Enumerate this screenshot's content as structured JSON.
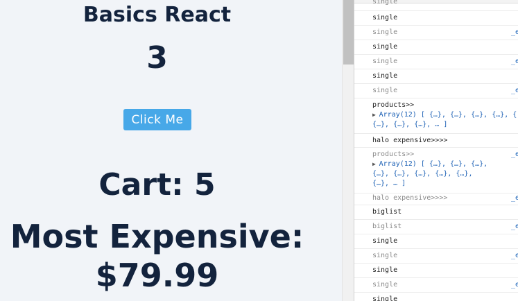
{
  "app": {
    "title": "Basics React",
    "counter": "3",
    "button_label": "Click Me",
    "cart_text": "Cart: 5",
    "expensive_line1": "Most Expensive:",
    "expensive_line2": "$79.99"
  },
  "console": {
    "rows": [
      {
        "text": "single",
        "dim": true,
        "source": ""
      },
      {
        "text": "single",
        "dim": false,
        "source": ""
      },
      {
        "text": "single",
        "dim": true,
        "source": "_e"
      },
      {
        "text": "single",
        "dim": false,
        "source": ""
      },
      {
        "text": "single",
        "dim": true,
        "source": "_e"
      },
      {
        "text": "single",
        "dim": false,
        "source": ""
      },
      {
        "text": "single",
        "dim": true,
        "source": "_e"
      },
      {
        "text": "products>>",
        "dim": false,
        "source": ""
      },
      {
        "text": "halo expensive>>>>",
        "dim": false,
        "source": ""
      },
      {
        "text": "products>>",
        "dim": true,
        "source": "_e"
      },
      {
        "text": "halo expensive>>>>",
        "dim": true,
        "source": "_e"
      },
      {
        "text": "biglist",
        "dim": false,
        "source": ""
      },
      {
        "text": "biglist",
        "dim": true,
        "source": "_e"
      },
      {
        "text": "single",
        "dim": false,
        "source": ""
      },
      {
        "text": "single",
        "dim": true,
        "source": "_e"
      },
      {
        "text": "single",
        "dim": false,
        "source": ""
      },
      {
        "text": "single",
        "dim": true,
        "source": "_e"
      },
      {
        "text": "single",
        "dim": false,
        "source": ""
      }
    ],
    "array1_lines": [
      "Array(12) [ {…}, {…}, {…}, {…}, {",
      "{…}, {…}, {…}, … ]"
    ],
    "array2_lines": [
      "Array(12) [ {…}, {…}, {…},",
      "{…}, {…}, {…}, {…}, {…},",
      "{…}, … ]"
    ],
    "expand_icon": "triangle-right-icon"
  }
}
